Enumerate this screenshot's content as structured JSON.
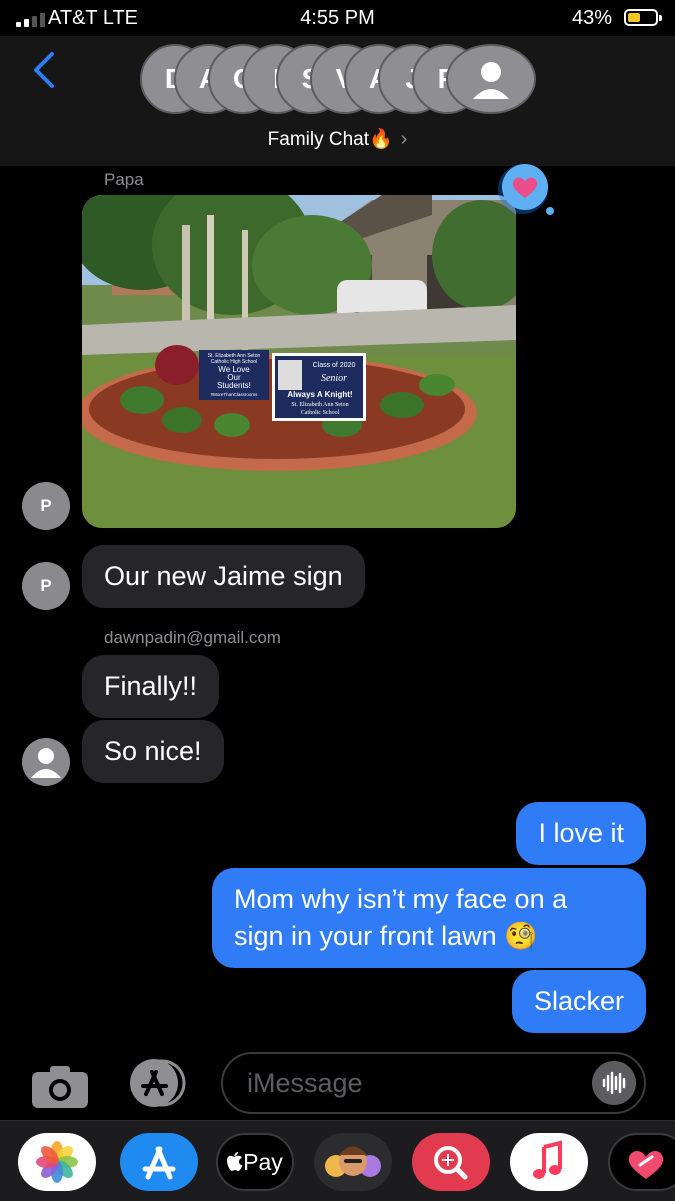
{
  "status_bar": {
    "carrier": "AT&T LTE",
    "time": "4:55 PM",
    "battery": "43%"
  },
  "header": {
    "avatar_letters": [
      "D",
      "A",
      "C",
      "I",
      "S",
      "V",
      "A",
      "J",
      "P",
      ""
    ],
    "group_name": "Family Chat🔥",
    "chevron": "›"
  },
  "messages": [
    {
      "sender": "Papa",
      "avatar": "P",
      "type": "image",
      "tapback": "heart"
    },
    {
      "avatar": "P",
      "text": "Our new Jaime sign"
    },
    {
      "sender": "dawnpadin@gmail.com",
      "text": "Finally!!"
    },
    {
      "avatar": "person",
      "text": "So nice!"
    },
    {
      "outgoing": true,
      "text": "I love it"
    },
    {
      "outgoing": true,
      "lines": [
        "Mom why isn’t my face on a",
        "sign in your front lawn 🧐"
      ]
    },
    {
      "outgoing": true,
      "text": "Slacker"
    }
  ],
  "photo": {
    "small_sign": [
      "St. Elizabeth Ann Seton",
      "Catholic High School",
      "We Love",
      "Our",
      "Students!",
      "#MoreThanClassrooms"
    ],
    "big_sign": [
      "Class of 2020",
      "Senior",
      "Always A Knight!",
      "St. Elizabeth Ann Seton",
      "Catholic School"
    ]
  },
  "composer": {
    "placeholder": "iMessage"
  },
  "app_drawer": [
    "photos-app",
    "app-store-app",
    "apple-pay-app",
    "memoji-app",
    "search-images-app",
    "music-app",
    "digital-touch-app"
  ],
  "apple_pay_label": "Pay",
  "colors": {
    "outgoing_bubble": "#2f7cf6",
    "incoming_bubble": "#26252a",
    "background": "#000000",
    "accent": "#2f7cf6"
  }
}
